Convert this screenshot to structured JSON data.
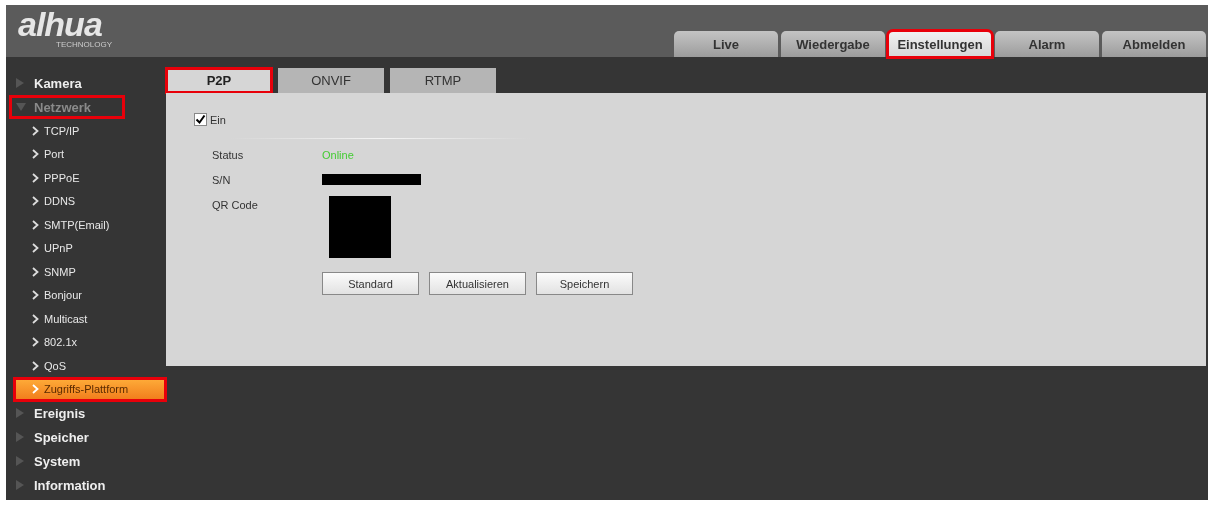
{
  "logo": {
    "text": "alhua",
    "subtext": "TECHNOLOGY"
  },
  "nav_tabs": [
    {
      "label": "Live",
      "selected": false,
      "highlighted": false
    },
    {
      "label": "Wiedergabe",
      "selected": false,
      "highlighted": false
    },
    {
      "label": "Einstellungen",
      "selected": true,
      "highlighted": true
    },
    {
      "label": "Alarm",
      "selected": false,
      "highlighted": false
    },
    {
      "label": "Abmelden",
      "selected": false,
      "highlighted": false
    }
  ],
  "sidebar": {
    "items": [
      {
        "label": "Kamera",
        "expanded": false,
        "highlighted": false
      },
      {
        "label": "Netzwerk",
        "expanded": true,
        "highlighted": true,
        "children": [
          {
            "label": "TCP/IP",
            "selected": false,
            "highlighted": false
          },
          {
            "label": "Port",
            "selected": false,
            "highlighted": false
          },
          {
            "label": "PPPoE",
            "selected": false,
            "highlighted": false
          },
          {
            "label": "DDNS",
            "selected": false,
            "highlighted": false
          },
          {
            "label": "SMTP(Email)",
            "selected": false,
            "highlighted": false
          },
          {
            "label": "UPnP",
            "selected": false,
            "highlighted": false
          },
          {
            "label": "SNMP",
            "selected": false,
            "highlighted": false
          },
          {
            "label": "Bonjour",
            "selected": false,
            "highlighted": false
          },
          {
            "label": "Multicast",
            "selected": false,
            "highlighted": false
          },
          {
            "label": "802.1x",
            "selected": false,
            "highlighted": false
          },
          {
            "label": "QoS",
            "selected": false,
            "highlighted": false
          },
          {
            "label": "Zugriffs-Plattform",
            "selected": true,
            "highlighted": true
          }
        ]
      },
      {
        "label": "Ereignis",
        "expanded": false,
        "highlighted": false
      },
      {
        "label": "Speicher",
        "expanded": false,
        "highlighted": false
      },
      {
        "label": "System",
        "expanded": false,
        "highlighted": false
      },
      {
        "label": "Information",
        "expanded": false,
        "highlighted": false
      }
    ]
  },
  "tabs": [
    {
      "label": "P2P",
      "selected": true,
      "highlighted": true
    },
    {
      "label": "ONVIF",
      "selected": false,
      "highlighted": false
    },
    {
      "label": "RTMP",
      "selected": false,
      "highlighted": false
    }
  ],
  "enable": {
    "label": "Ein",
    "checked": true
  },
  "fields": [
    {
      "label": "Status",
      "kind": "status",
      "value": "Online",
      "color": "#44cc33"
    },
    {
      "label": "S/N",
      "kind": "redacted"
    },
    {
      "label": "QR Code",
      "kind": "qr"
    }
  ],
  "buttons": [
    "Standard",
    "Aktualisieren",
    "Speichern"
  ]
}
